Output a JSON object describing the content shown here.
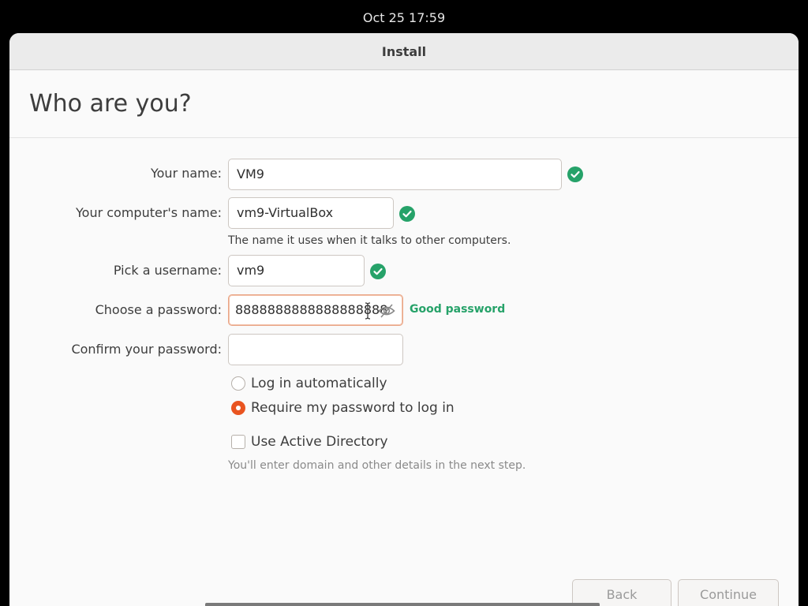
{
  "topbar": {
    "clock": "Oct 25  17:59"
  },
  "window": {
    "title": "Install"
  },
  "page": {
    "heading": "Who are you?"
  },
  "form": {
    "name": {
      "label": "Your name:",
      "value": "VM9",
      "valid": true
    },
    "computer_name": {
      "label": "Your computer's name:",
      "value": "vm9-VirtualBox",
      "hint": "The name it uses when it talks to other computers.",
      "valid": true
    },
    "username": {
      "label": "Pick a username:",
      "value": "vm9",
      "valid": true
    },
    "password": {
      "label": "Choose a password:",
      "value": "8888888888888888888",
      "strength": "Good password"
    },
    "confirm_password": {
      "label": "Confirm your password:",
      "value": ""
    },
    "login_options": {
      "auto_login": {
        "label": "Log in automatically",
        "selected": false
      },
      "require_password": {
        "label": "Require my password to log in",
        "selected": true
      }
    },
    "active_directory": {
      "label": "Use Active Directory",
      "checked": false,
      "hint": "You'll enter domain and other details in the next step."
    }
  },
  "buttons": {
    "back": "Back",
    "continue": "Continue"
  },
  "colors": {
    "accent": "#e95420",
    "success": "#26a269",
    "focus_border": "#e9a586"
  },
  "icons": {
    "valid": "check-circle-icon",
    "password_visibility": "eye-slash-icon"
  }
}
